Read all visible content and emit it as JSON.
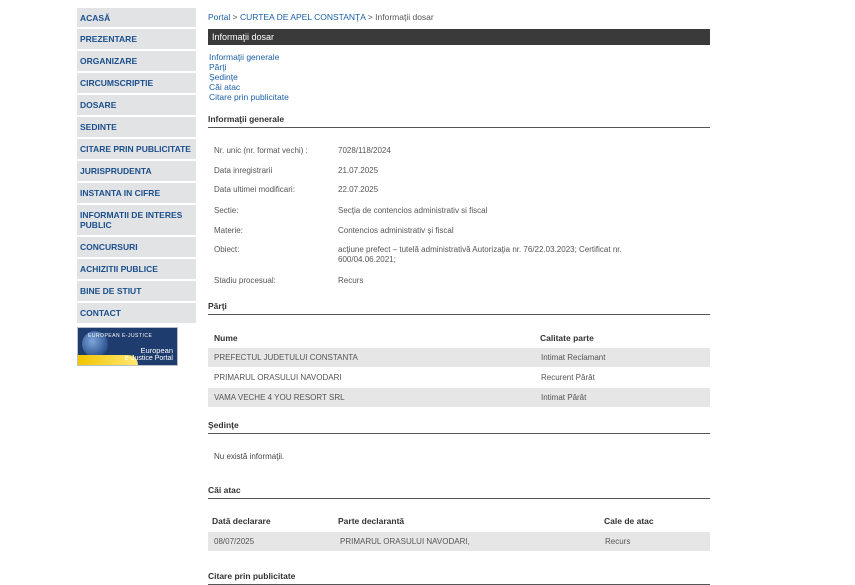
{
  "sidebar": {
    "items": [
      {
        "label": "ACASĂ"
      },
      {
        "label": "PREZENTARE"
      },
      {
        "label": "ORGANIZARE"
      },
      {
        "label": "CIRCUMSCRIPTIE"
      },
      {
        "label": "DOSARE"
      },
      {
        "label": "SEDINTE"
      },
      {
        "label": "CITARE PRIN PUBLICITATE"
      },
      {
        "label": "JURISPRUDENTA"
      },
      {
        "label": "INSTANTA IN CIFRE"
      },
      {
        "label": "INFORMATII DE INTERES PUBLIC"
      },
      {
        "label": "CONCURSURI"
      },
      {
        "label": "ACHIZITII PUBLICE"
      },
      {
        "label": "BINE DE STIUT"
      },
      {
        "label": "CONTACT"
      }
    ],
    "banner": {
      "small": "EUROPEAN E-JUSTICE",
      "line1": "European",
      "line2": "e-Justice Portal"
    }
  },
  "breadcrumb": {
    "portal": "Portal",
    "sep1": ">",
    "court": "CURTEA DE APEL CONSTANŢA",
    "sep2": ">",
    "current": "Informaţii dosar"
  },
  "title_bar": "Informaţii dosar",
  "quick_links": [
    "Informaţii generale",
    "Părţi",
    "Şedinţe",
    "Căi atac",
    "Citare prin publicitate"
  ],
  "general": {
    "heading": "Informaţii generale",
    "fields": [
      {
        "k": "Nr. unic (nr. format vechi) :",
        "v": "7028/118/2024"
      },
      {
        "k": "Data inregistrarii",
        "v": "21.07.2025"
      },
      {
        "k": "Data ultimei modificari:",
        "v": "22.07.2025"
      },
      {
        "k": "Sectie:",
        "v": "Secţia de contencios administrativ si fiscal"
      },
      {
        "k": "Materie:",
        "v": "Contencios administrativ şi fiscal"
      },
      {
        "k": "Obiect:",
        "v": "acţiune prefect – tutelă administrativă Autorizaţia nr. 76/22.03.2023; Certificat nr. 600/04.06.2021;"
      },
      {
        "k": "Stadiu procesual:",
        "v": "Recurs"
      }
    ]
  },
  "parti": {
    "heading": "Părţi",
    "columns": [
      "Nume",
      "Calitate parte"
    ],
    "rows": [
      [
        "PREFECTUL JUDETULUI CONSTANTA",
        "Intimat Reclamant"
      ],
      [
        "PRIMARUL ORASULUI NAVODARI",
        "Recurent Pârât"
      ],
      [
        "VAMA VECHE 4 YOU RESORT SRL",
        "Intimat Pârât"
      ]
    ]
  },
  "sedinte": {
    "heading": "Şedinţe",
    "empty": "Nu există informaţii."
  },
  "cai_atac": {
    "heading": "Căi atac",
    "columns": [
      "Dată declarare",
      "Parte declarantă",
      "Cale de atac"
    ],
    "rows": [
      [
        "08/07/2025",
        "PRIMARUL ORASULUI NAVODARI,",
        "Recurs"
      ]
    ]
  },
  "citare": {
    "heading": "Citare prin publicitate"
  }
}
